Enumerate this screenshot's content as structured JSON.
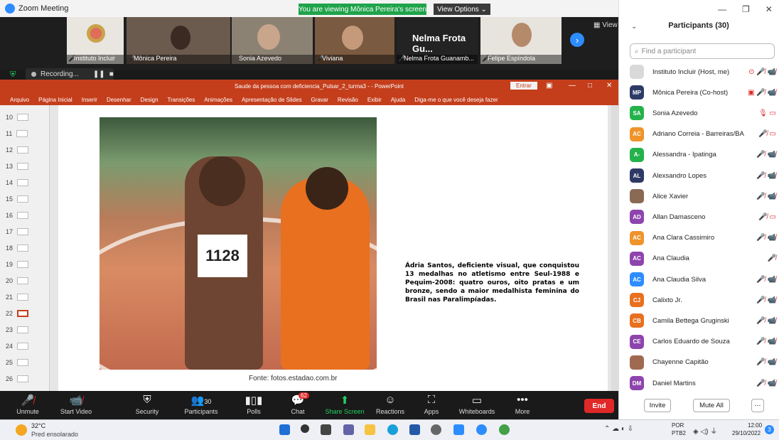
{
  "window": {
    "title": "Zoom Meeting"
  },
  "share_banner": "You are viewing Mônica Pereira's screen",
  "view_options": "View Options ⌄",
  "video_tiles": [
    {
      "name": "Instituto Incluir",
      "muted": true
    },
    {
      "name": "Mônica Pereira",
      "muted": true
    },
    {
      "name": "Sonia Azevedo",
      "muted": false
    },
    {
      "name": "Viviana",
      "muted": true
    },
    {
      "name": "Nelma Frota Guanamb...",
      "big_name": "Nelma Frota Gu...",
      "muted": true
    },
    {
      "name": "Felipe Espíndola",
      "muted": true
    }
  ],
  "view_button": "View",
  "recording": {
    "label": "Recording..."
  },
  "powerpoint": {
    "doc_title": "Saude da pessoa com deficiencia_Pulsar_2_turma3 - - PowerPoint",
    "entrar": "Entrar",
    "ribbon": [
      "Arquivo",
      "Página Inicial",
      "Inserir",
      "Desenhar",
      "Design",
      "Transições",
      "Animações",
      "Apresentação de Slides",
      "Gravar",
      "Revisão",
      "Exibir",
      "Ajuda",
      "Diga-me o que você deseja fazer"
    ],
    "thumbs": [
      "10",
      "11",
      "12",
      "13",
      "14",
      "15",
      "16",
      "17",
      "18",
      "19",
      "20",
      "21",
      "22",
      "23",
      "24",
      "25",
      "26"
    ],
    "selected_thumb": "22",
    "bib_number": "1128",
    "slide_text": "Ádria Santos, deficiente visual, que conquistou 13 medalhas no atletismo entre Seul-1988 e Pequim-2008: quatro ouros, oito pratas e um bronze, sendo a maior medalhista feminina do Brasil nas Paralimpíadas.",
    "caption": "Fonte: fotos.estadao.com.br"
  },
  "toolbar": {
    "unmute": "Unmute",
    "start_video": "Start Video",
    "security": "Security",
    "participants": "Participants",
    "participants_count": "30",
    "polls": "Polls",
    "chat": "Chat",
    "chat_badge": "62",
    "share_screen": "Share Screen",
    "reactions": "Reactions",
    "apps": "Apps",
    "whiteboards": "Whiteboards",
    "more": "More",
    "end": "End"
  },
  "panel": {
    "title": "Participants (30)",
    "find_placeholder": "Find a participant",
    "invite": "Invite",
    "mute_all": "Mute All",
    "participants": [
      {
        "initials": "",
        "name": "Instituto Incluir (Host, me)",
        "color": "#d9d9d9",
        "icons": "⊙ 🎤̸ 📹̸"
      },
      {
        "initials": "MP",
        "name": "Mônica Pereira (Co-host)",
        "color": "#2e3a66",
        "icons": "▣ 🎤̸ 📹̸"
      },
      {
        "initials": "SA",
        "name": "Sonia Azevedo",
        "color": "#24b24b",
        "icons": "🎙 ▭"
      },
      {
        "initials": "AC",
        "name": "Adriano Correia - Barreiras/BA",
        "color": "#f0932b",
        "icons": "🎤̸ ▭"
      },
      {
        "initials": "A-",
        "name": "Alessandra - Ipatinga",
        "color": "#24b24b",
        "icons": "🎤̸ 📹̸"
      },
      {
        "initials": "AL",
        "name": "Alexsandro Lopes",
        "color": "#2e3a66",
        "icons": "🎤̸ 📹̸"
      },
      {
        "initials": "",
        "name": "Alice Xavier",
        "color": "#8a6a55",
        "icons": "🎤̸ 📹̸"
      },
      {
        "initials": "AD",
        "name": "Allan Damasceno",
        "color": "#8e44ad",
        "icons": "🎤̸ ▭"
      },
      {
        "initials": "AC",
        "name": "Ana Clara Cassimiro",
        "color": "#f0932b",
        "icons": "🎤̸ 📹̸"
      },
      {
        "initials": "AC",
        "name": "Ana Claudia",
        "color": "#8e44ad",
        "icons": "🎤̸"
      },
      {
        "initials": "AC",
        "name": "Ana Claudia Silva",
        "color": "#2d8cff",
        "icons": "🎤̸ 📹̸"
      },
      {
        "initials": "CJ",
        "name": "Calixto Jr.",
        "color": "#e8701f",
        "icons": "🎤̸ 📹̸"
      },
      {
        "initials": "CB",
        "name": "Camila Bettega Gruginski",
        "color": "#e8701f",
        "icons": "🎤̸ 📹̸"
      },
      {
        "initials": "CE",
        "name": "Carlos Eduardo de Souza",
        "color": "#8e44ad",
        "icons": "🎤̸ 📹̸"
      },
      {
        "initials": "",
        "name": "Chayenne Capitão",
        "color": "#a06a50",
        "icons": "🎤̸ 📹̸"
      },
      {
        "initials": "DM",
        "name": "Daniel Martins",
        "color": "#8e44ad",
        "icons": "🎤̸ 📹̸"
      }
    ]
  },
  "taskbar": {
    "temp": "32°C",
    "weather": "Pred ensolarado",
    "lang1": "POR",
    "lang2": "PTB2",
    "time": "12:00",
    "date": "29/10/2022",
    "notif": "3"
  }
}
